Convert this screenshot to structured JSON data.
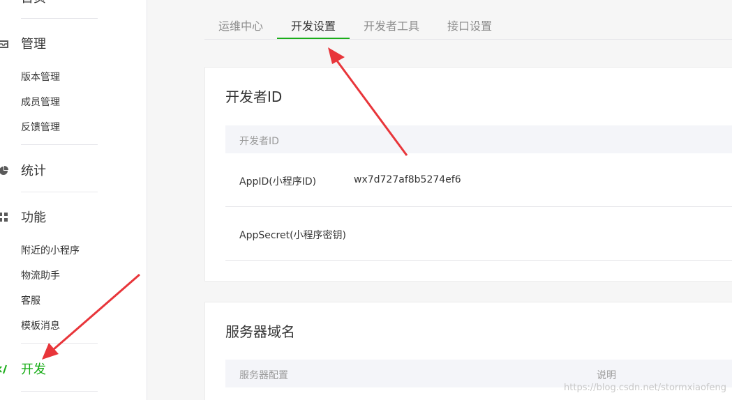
{
  "sidebar": {
    "top_partial_label": "首页",
    "sections": [
      {
        "label": "管理",
        "icon": "inbox-icon"
      },
      {
        "label": "统计",
        "icon": "pie-chart-icon"
      },
      {
        "label": "功能",
        "icon": "grid-icon"
      },
      {
        "label": "开发",
        "icon": "code-icon"
      }
    ],
    "manage_items": [
      "版本管理",
      "成员管理",
      "反馈管理"
    ],
    "feature_items": [
      "附近的小程序",
      "物流助手",
      "客服",
      "模板消息"
    ]
  },
  "tabs": [
    "运维中心",
    "开发设置",
    "开发者工具",
    "接口设置"
  ],
  "active_tab": "开发设置",
  "developer_card": {
    "title": "开发者ID",
    "header": "开发者ID",
    "rows": [
      {
        "label": "AppID(小程序ID)",
        "value": "wx7d727af8b5274ef6"
      },
      {
        "label": "AppSecret(小程序密钥)",
        "value": ""
      }
    ]
  },
  "server_card": {
    "title": "服务器域名",
    "header_col1": "服务器配置",
    "header_col2": "说明"
  },
  "watermark": "https://blog.csdn.net/stormxiaofeng",
  "colors": {
    "accent": "#1aad19",
    "annotation_arrow": "#e8353a"
  }
}
